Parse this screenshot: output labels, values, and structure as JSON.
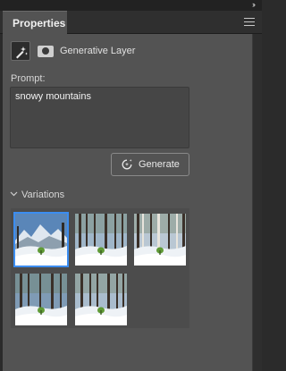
{
  "panel": {
    "tab_title": "Properties",
    "layer_type": "Generative Layer"
  },
  "prompt": {
    "label": "Prompt:",
    "value": "snowy mountains"
  },
  "generate_button": {
    "label": "Generate"
  },
  "variations": {
    "label": "Variations",
    "selected_index": 0,
    "items": [
      {
        "variant": "mountain-view"
      },
      {
        "variant": "forest-sunny"
      },
      {
        "variant": "forest-birch"
      },
      {
        "variant": "forest-clearing"
      },
      {
        "variant": "forest-bright"
      }
    ]
  },
  "colors": {
    "accent": "#3c8df0",
    "panel_bg": "#535353",
    "app_bg": "#2b2b2b"
  }
}
